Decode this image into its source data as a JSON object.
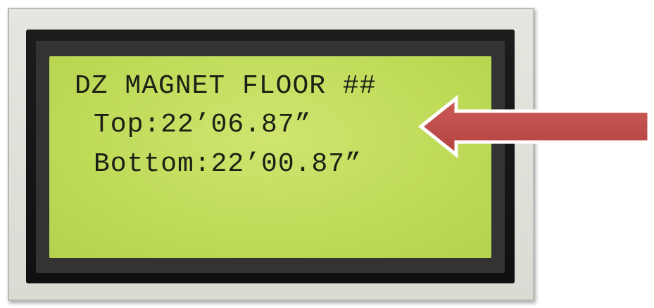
{
  "display": {
    "line1": "DZ MAGNET FLOOR ##",
    "line2": "Top:22’06.87”",
    "line3": "Bottom:22’00.87”"
  },
  "colors": {
    "lcd_background": "#bedb58",
    "lcd_text": "#1d1f14",
    "bezel_outer": "#e0dfd8",
    "bezel_frame": "#141414",
    "arrow_fill": "#c0504d"
  },
  "icons": {
    "arrow": "left-arrow-icon"
  }
}
